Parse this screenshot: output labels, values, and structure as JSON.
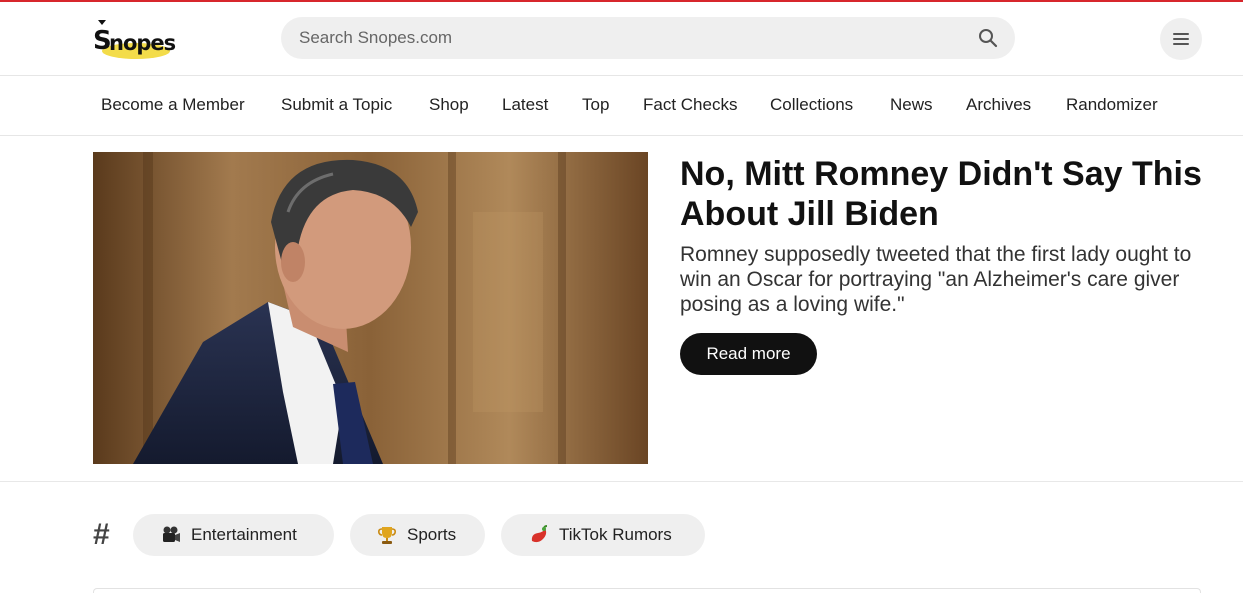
{
  "colors": {
    "accent_red": "#d7262c",
    "logo_yellow": "#f3dc4a",
    "button_dark": "#111111",
    "chip_bg": "#efefef"
  },
  "header": {
    "logo_text": "Snopes",
    "search": {
      "placeholder": "Search Snopes.com",
      "value": "",
      "icon": "search-icon"
    },
    "menu_icon": "hamburger-menu-icon"
  },
  "nav": {
    "items": [
      {
        "label": "Become a Member"
      },
      {
        "label": "Submit a Topic"
      },
      {
        "label": "Shop"
      },
      {
        "label": "Latest"
      },
      {
        "label": "Top"
      },
      {
        "label": "Fact Checks"
      },
      {
        "label": "Collections"
      },
      {
        "label": "News"
      },
      {
        "label": "Archives"
      },
      {
        "label": "Randomizer"
      }
    ]
  },
  "hero": {
    "title": "No, Mitt Romney Didn't Say This About Jill Biden",
    "description": "Romney supposedly tweeted that the first lady ought to win an Oscar for portraying \"an Alzheimer's care giver posing as a loving wife.\"",
    "cta_label": "Read more"
  },
  "tags": {
    "hash_symbol": "#",
    "items": [
      {
        "label": "Entertainment",
        "icon": "film-camera-icon"
      },
      {
        "label": "Sports",
        "icon": "trophy-icon"
      },
      {
        "label": "TikTok Rumors",
        "icon": "tiktok-hot-pepper-icon"
      }
    ]
  }
}
